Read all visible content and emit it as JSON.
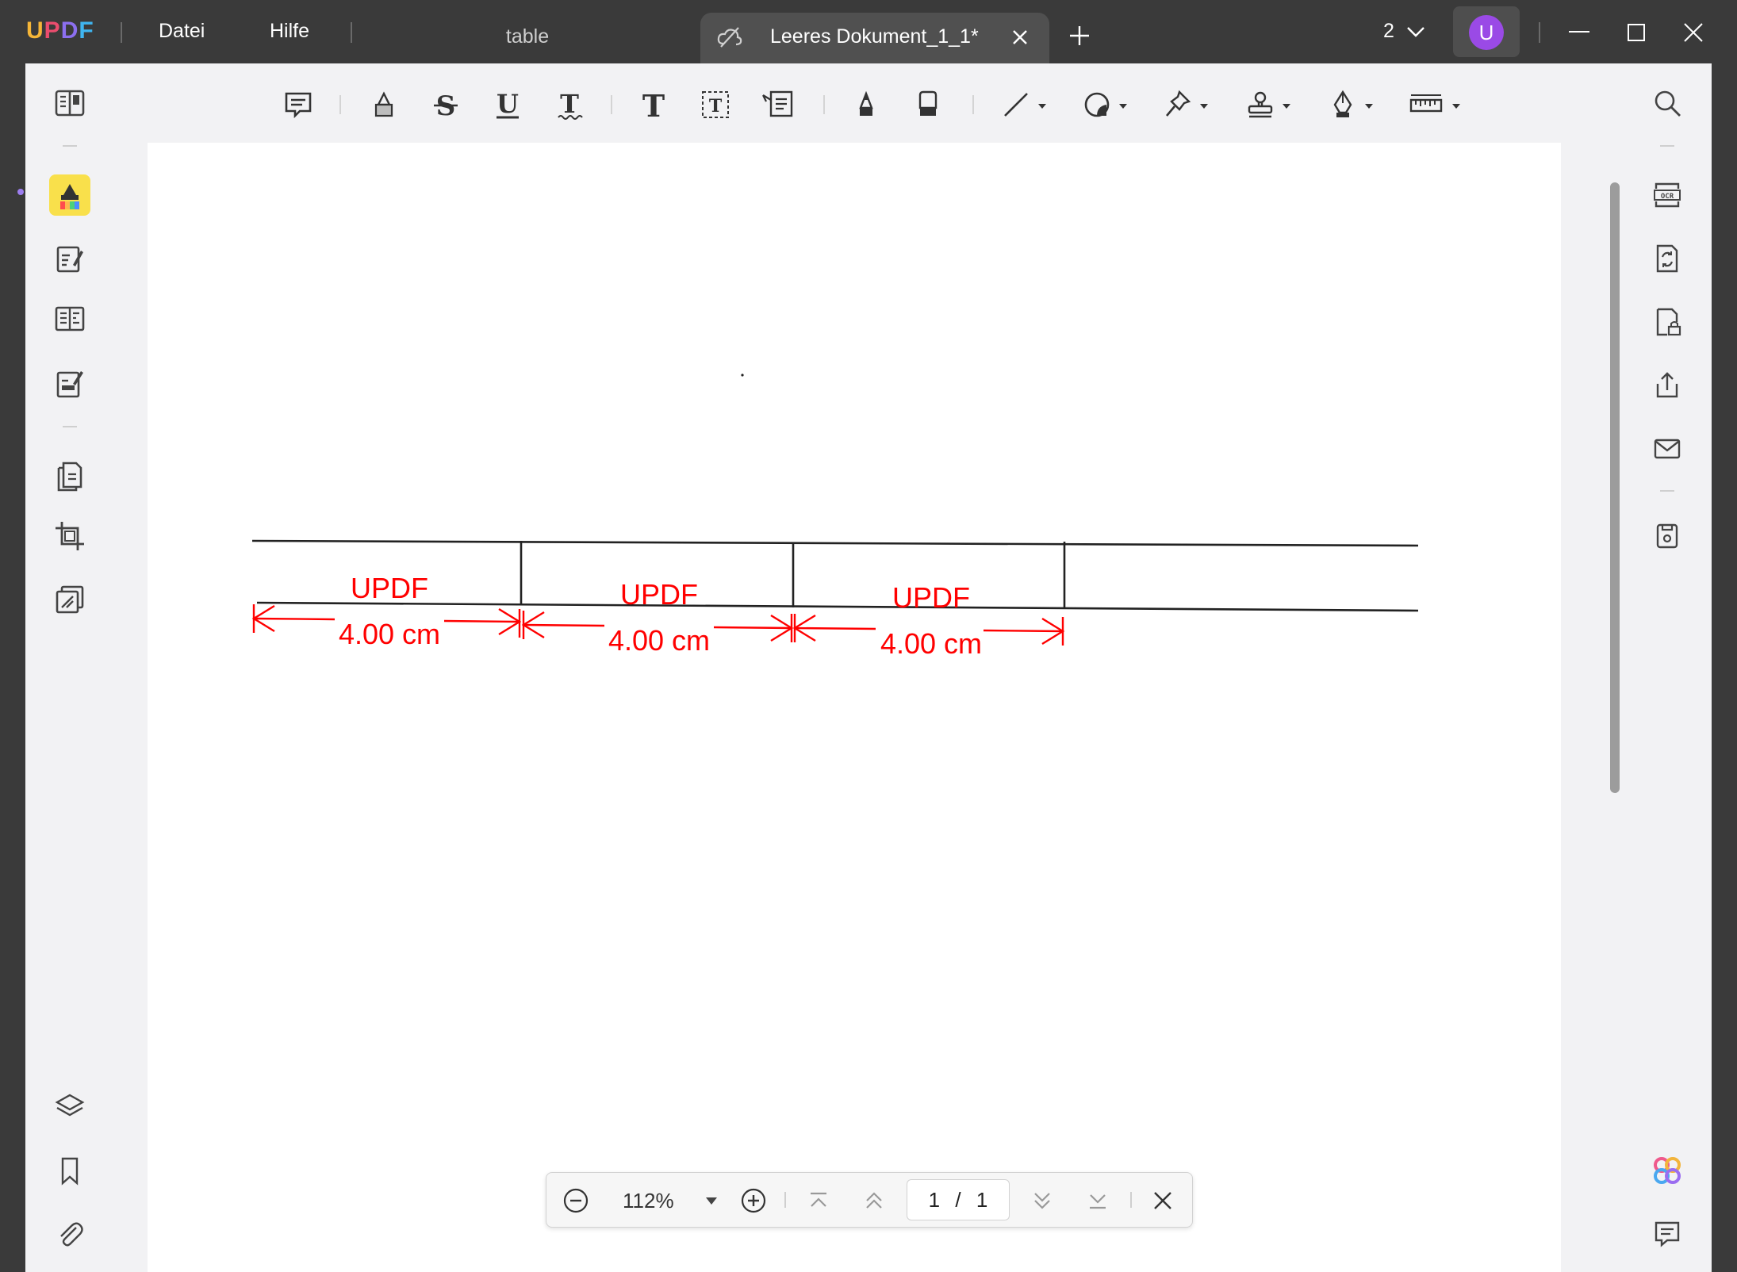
{
  "app": {
    "logo": {
      "u": "U",
      "p": "P",
      "d": "D",
      "f": "F"
    },
    "menu": {
      "file": "Datei",
      "help": "Hilfe"
    },
    "tabs": [
      {
        "label": "table",
        "active": false
      },
      {
        "label": "Leeres Dokument_1_1*",
        "active": true
      }
    ],
    "window_count": "2",
    "user_initial": "U",
    "accent_color": "#9a4ae6",
    "highlight_color": "#f9e04b"
  },
  "toolbar": {
    "tools": [
      "comment-icon",
      "highlight-icon",
      "strikethrough-icon",
      "underline-icon",
      "squiggly-underline-icon",
      "text-icon",
      "textbox-icon",
      "callout-icon",
      "pencil-icon",
      "eraser-icon",
      "line-icon",
      "shape-icon",
      "pin-icon",
      "stamp-icon",
      "signature-icon",
      "measure-icon"
    ]
  },
  "document": {
    "measurements": [
      {
        "label": "UPDF",
        "value": "4.00 cm"
      },
      {
        "label": "UPDF",
        "value": "4.00 cm"
      },
      {
        "label": "UPDF",
        "value": "4.00 cm"
      }
    ],
    "annotation_color": "#ff0000"
  },
  "zoom": {
    "level": "112%",
    "current_page": "1",
    "page_sep": "/",
    "total_pages": "1"
  }
}
